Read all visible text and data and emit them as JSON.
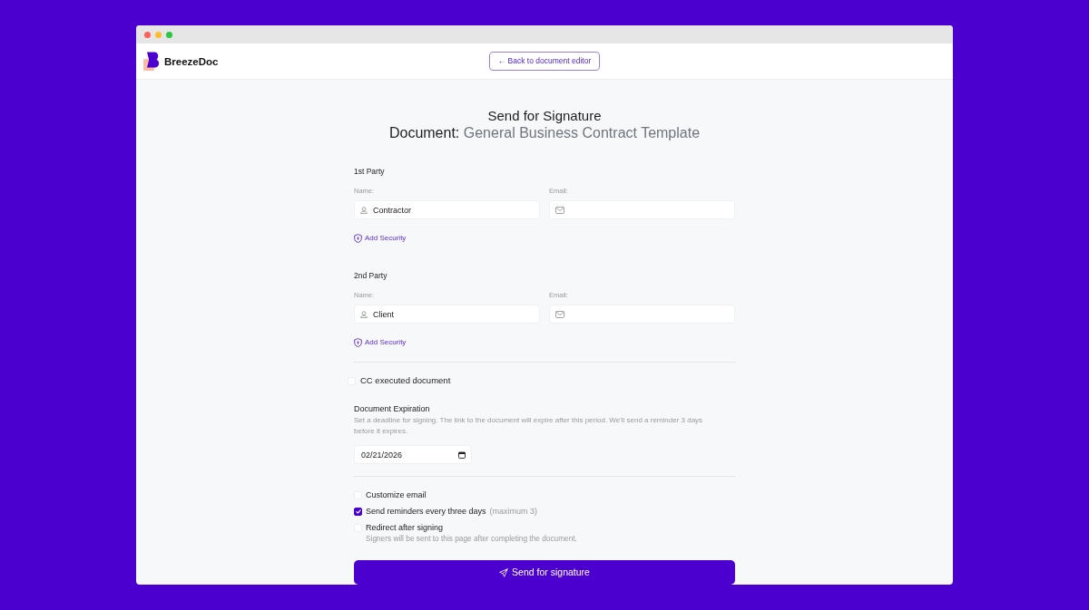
{
  "header": {
    "brand": "BreezeDoc",
    "back_button": "← Back to document editor"
  },
  "heading": {
    "title": "Send for Signature",
    "document_label": "Document:",
    "document_name": "General Business Contract Template"
  },
  "parties": [
    {
      "title": "1st Party",
      "name_label": "Name:",
      "name_value": "Contractor",
      "email_label": "Email:",
      "add_security": "Add Security"
    },
    {
      "title": "2nd Party",
      "name_label": "Name:",
      "name_value": "Client",
      "email_label": "Email:",
      "add_security": "Add Security"
    }
  ],
  "cc": {
    "label": "CC executed document",
    "checked": false
  },
  "expiration": {
    "title": "Document Expiration",
    "description": "Set a deadline for signing. The link to the document will expire after this period. We'll send a reminder 3 days before it expires.",
    "value": "02/21/2026"
  },
  "options": [
    {
      "label": "Customize email",
      "checked": false
    },
    {
      "label": "Send reminders every three days",
      "note": "(maximum 3)",
      "checked": true
    },
    {
      "label": "Redirect after signing",
      "hint": "Signers will be sent to this page after completing the document.",
      "checked": false
    }
  ],
  "submit_button": "Send for signature"
}
